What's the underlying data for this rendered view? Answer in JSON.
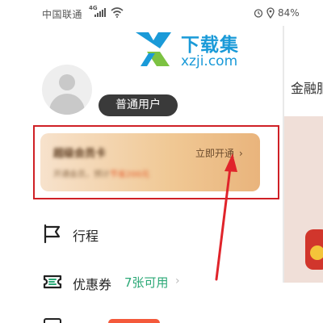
{
  "status_bar": {
    "carrier": "中国联通",
    "network": "4G",
    "battery": "84%"
  },
  "watermark": {
    "title": "下载集",
    "url": "xzji.com"
  },
  "background_app": {
    "title": "金融服"
  },
  "profile": {
    "user_level": "普通用户"
  },
  "vip_card": {
    "title": "超级会员卡",
    "subtitle_prefix": "开通会员，预计",
    "subtitle_highlight": "节省200元",
    "cta": "立即开通"
  },
  "menu": {
    "items": [
      {
        "label": "行程",
        "icon": "flag-icon"
      },
      {
        "label": "优惠券",
        "icon": "coupon-icon",
        "count": "7张可用"
      }
    ]
  },
  "colors": {
    "highlight_box": "#cf2026",
    "arrow": "#e0242b",
    "coupon_count": "#2aa876",
    "brand": "#1a9ad8"
  }
}
